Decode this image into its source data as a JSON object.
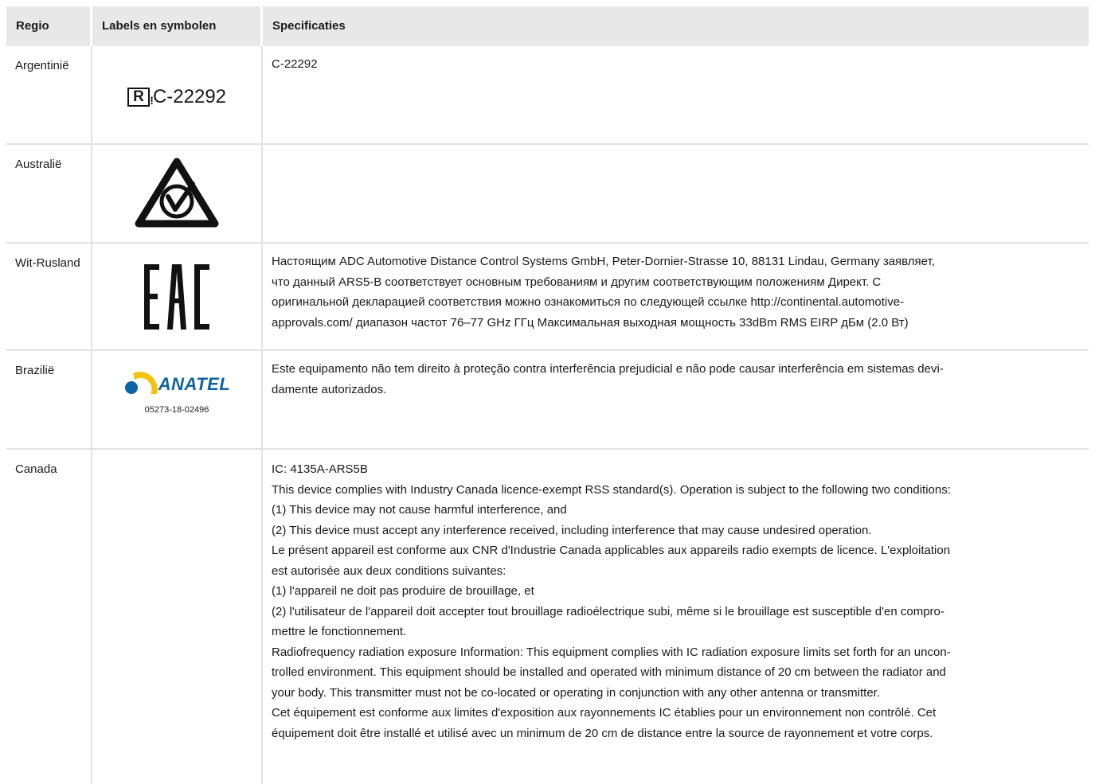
{
  "header": {
    "col1": "Regio",
    "col2": "Labels en symbolen",
    "col3": "Specificaties"
  },
  "rows": [
    {
      "region": "Argentinië",
      "label_text": "C-22292",
      "label_icon": "registered-r-mark-icon",
      "spec": [
        "C-22292"
      ]
    },
    {
      "region": "Australië",
      "label_icon": "rcm-compliance-mark-icon",
      "spec": []
    },
    {
      "region": "Wit-Rusland",
      "label_icon": "eac-mark-icon",
      "spec": [
        "Настоящим ADC Automotive Distance Control Systems GmbH, Peter-Dornier-Strasse 10, 88131 Lindau, Germany заявляет,",
        "что данный ARS5-B соответствует основным требованиям и другим соответствующим положениям Директ. С",
        "оригинальной декларацией соответствия можно ознакомиться по следующей ссылке http://continental.automotive-",
        "approvals.com/ диапазон частот 76–77 GHz ГГц Максимальная выходная мощность 33dBm RMS EIRP дБм (2.0 Вт)"
      ]
    },
    {
      "region": "Brazilië",
      "label_text": "ANATEL",
      "label_number": "05273-18-02496",
      "label_icon": "anatel-logo-icon",
      "spec": [
        "Este equipamento não tem direito à proteção contra interferência prejudicial e não pode causar interferência em sistemas devi-",
        "damente autorizados."
      ]
    },
    {
      "region": "Canada",
      "spec": [
        "IC: 4135A-ARS5B",
        "This device complies with Industry Canada licence-exempt RSS standard(s). Operation is subject to the following two conditions:",
        "(1) This device may not cause harmful interference, and",
        "(2) This device must accept any interference received, including interference that may cause undesired operation.",
        "Le présent appareil est conforme aux CNR d'Industrie Canada applicables aux appareils radio exempts de licence. L'exploitation",
        "est autorisée aux deux conditions suivantes:",
        "(1) l'appareil ne doit pas produire de brouillage, et",
        "(2) l'utilisateur de l'appareil doit accepter tout brouillage radioélectrique subi, même si le brouillage est susceptible d'en compro-",
        "mettre le fonctionnement.",
        "Radiofrequency radiation exposure Information: This equipment complies with IC radiation exposure limits set forth for an uncon-",
        "trolled environment. This equipment should be installed and operated with minimum distance of 20 cm between the radiator and",
        "your body. This transmitter must not be co-located or operating in conjunction with any other antenna or transmitter.",
        "Cet équipement est conforme aux limites d'exposition aux rayonnements IC établies pour un environnement non contrôlé. Cet",
        "équipement doit être installé et utilisé avec un minimum de 20 cm de distance entre la source de rayonnement et votre corps."
      ]
    }
  ]
}
